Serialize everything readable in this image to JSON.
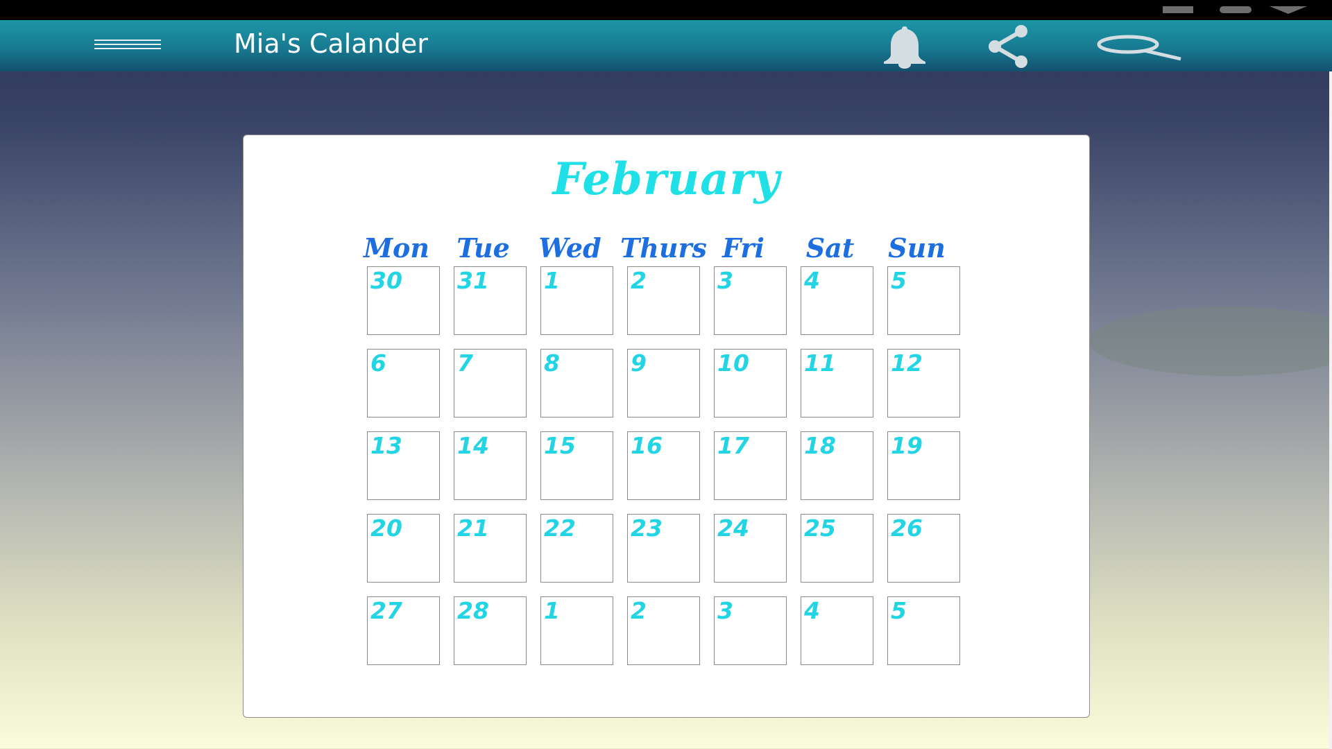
{
  "app": {
    "title": "Mia's Calander"
  },
  "header_icons": [
    "menu-icon",
    "bell-icon",
    "share-icon",
    "search-icon"
  ],
  "calendar": {
    "month": "February",
    "weekdays": [
      "Mon",
      "Tue",
      "Wed",
      "Thurs",
      "Fri",
      "Sat",
      "Sun"
    ],
    "weeks": [
      [
        "30",
        "31",
        "1",
        "2",
        "3",
        "4",
        "5"
      ],
      [
        "6",
        "7",
        "8",
        "9",
        "10",
        "11",
        "12"
      ],
      [
        "13",
        "14",
        "15",
        "16",
        "17",
        "18",
        "19"
      ],
      [
        "20",
        "21",
        "22",
        "23",
        "24",
        "25",
        "26"
      ],
      [
        "27",
        "28",
        "1",
        "2",
        "3",
        "4",
        "5"
      ]
    ]
  },
  "colors": {
    "month_title": "#1ee0e6",
    "weekday": "#1d6fe0",
    "day_number": "#22d4e4",
    "header_top": "#1d96a6",
    "header_bottom": "#13506e"
  }
}
